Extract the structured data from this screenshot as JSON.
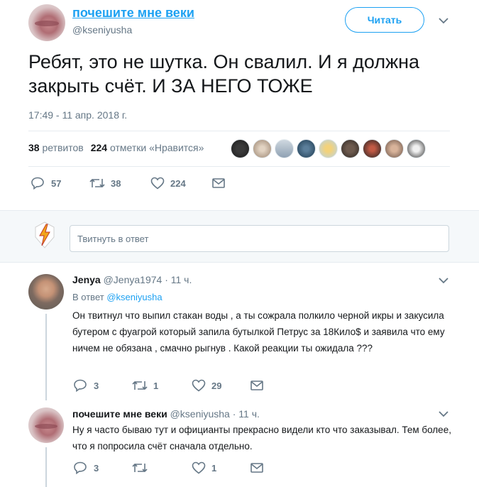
{
  "main_tweet": {
    "display_name": "почешите мне веки",
    "handle": "@kseniyusha",
    "follow_label": "Читать",
    "text": "Ребят, это не шутка. Он свалил. И я должна\nзакрыть счёт.  И ЗА НЕГО ТОЖЕ",
    "timestamp": "17:49 - 11 апр. 2018 г.",
    "retweets_count": "38",
    "retweets_label": "ретвитов",
    "likes_count": "224",
    "likes_label": "отметки «Нравится»",
    "reply_count": "57",
    "retweet_action_count": "38",
    "like_action_count": "224"
  },
  "reply_box": {
    "placeholder": "Твитнуть в ответ"
  },
  "replies": [
    {
      "display_name": "Jenya",
      "handle": "@Jenya1974",
      "time": "· 11 ч.",
      "in_reply_prefix": "В ответ",
      "in_reply_handle": "@kseniyusha",
      "text": "Он твитнул что выпил стакан воды , а ты сожрала полкило черной икры и закусила бутером с фуагрой который запила бутылкой Петрус за 18Кило$  и заявила что ему ничем не обязана , смачно рыгнув . Какой реакции ты ожидала ???",
      "reply_count": "3",
      "retweet_count": "1",
      "like_count": "29"
    },
    {
      "display_name": "почешите мне веки",
      "handle": "@kseniyusha",
      "time": "· 11 ч.",
      "text": "Ну я часто бываю тут и официанты прекрасно видели кто что заказывал. Тем более, что я попросила счёт сначала отдельно.",
      "reply_count": "3",
      "retweet_count": "",
      "like_count": "1"
    }
  ],
  "colors": {
    "accent": "#1da1f2",
    "secondary_text": "#657786",
    "divider": "#e6ecf0"
  },
  "icons": [
    "reply-icon",
    "retweet-icon",
    "like-icon",
    "message-icon",
    "chevron-down-icon",
    "bolt-icon"
  ]
}
